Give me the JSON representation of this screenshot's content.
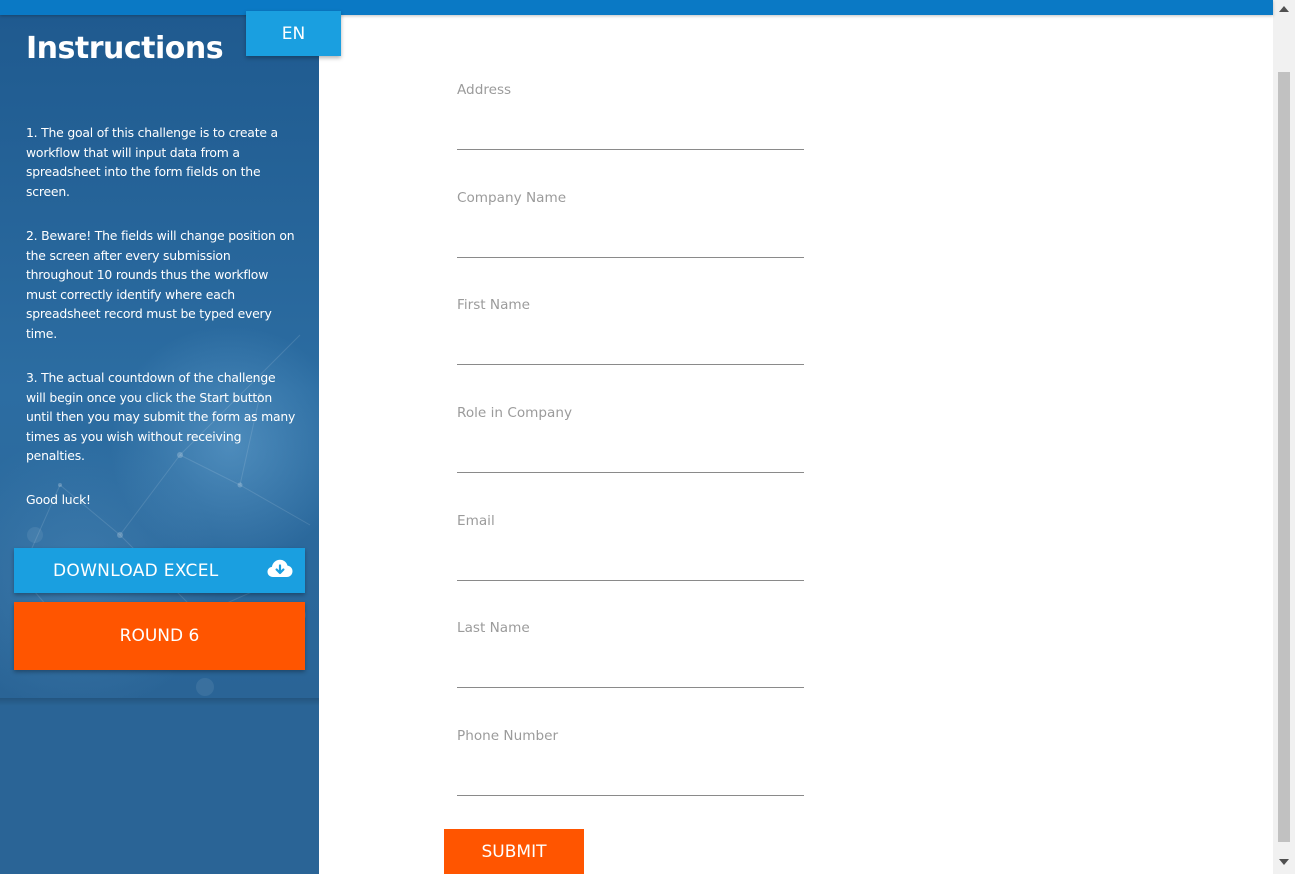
{
  "sidebar": {
    "title": "Instructions",
    "language_button": "EN",
    "instructions": [
      "1. The goal of this challenge is to create a workflow that will input data from a spreadsheet into the form fields on the screen.",
      "2. Beware! The fields will change position on the screen after every submission throughout 10 rounds thus the workflow must correctly identify where each spreadsheet record must be typed every time.",
      "3. The actual countdown of the challenge will begin once you click the Start button until then you may submit the form as many times as you wish without receiving penalties.",
      "Good luck!"
    ],
    "download_button": "DOWNLOAD EXCEL",
    "download_icon": "cloud-download-icon",
    "round_button": "ROUND 6"
  },
  "form": {
    "fields": [
      {
        "label": "Address",
        "value": ""
      },
      {
        "label": "Company Name",
        "value": ""
      },
      {
        "label": "First Name",
        "value": ""
      },
      {
        "label": "Role in Company",
        "value": ""
      },
      {
        "label": "Email",
        "value": ""
      },
      {
        "label": "Last Name",
        "value": ""
      },
      {
        "label": "Phone Number",
        "value": ""
      }
    ],
    "submit_button": "SUBMIT"
  },
  "colors": {
    "topbar": "#0a79c5",
    "sidebar": "#2a6496",
    "blue_button": "#1a9fe0",
    "orange_button": "#ff5500",
    "label": "#9b9b9b"
  }
}
